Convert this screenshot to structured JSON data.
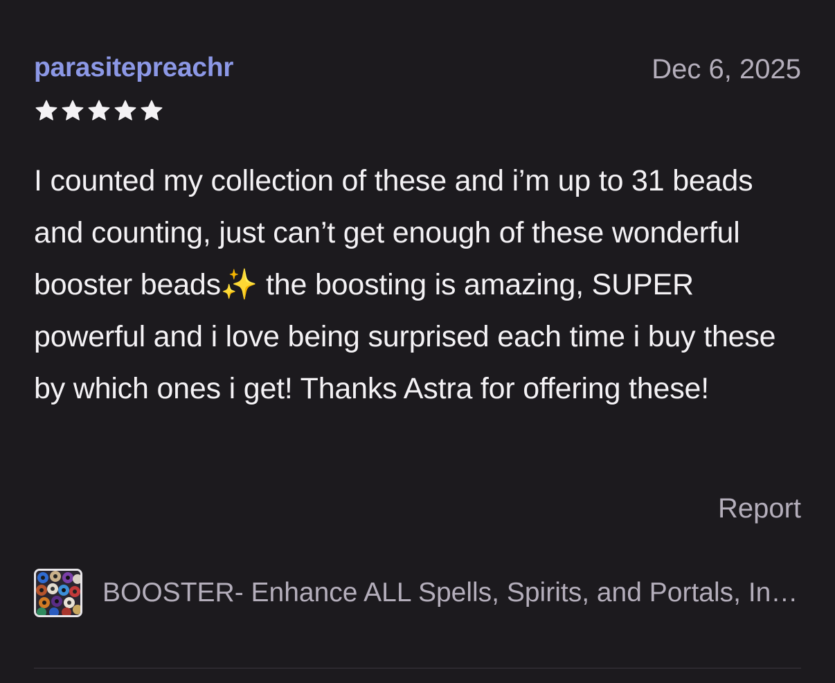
{
  "review": {
    "reviewer_name": "parasitepreachr",
    "date": "Dec 6, 2025",
    "rating": 5,
    "rating_max": 5,
    "text": "I counted my collection of these and i’m up to 31 beads and counting, just can’t get enough of these wonderful booster beads✨ the boosting is amazing, SUPER powerful and i love being surprised each time i buy these by which ones i get! Thanks Astra for offering these!",
    "report_label": "Report"
  },
  "listing": {
    "title": "BOOSTER- Enhance ALL Spells, Spirits, and Portals, Increase Results",
    "thumbnail_icon": "bead-collection-thumbnail"
  },
  "colors": {
    "background": "#1c1a1e",
    "reviewer_name": "#8c98e6",
    "body_text": "#f4f2f5",
    "muted_text": "#b4aebb",
    "star": "#f4f2f5"
  }
}
